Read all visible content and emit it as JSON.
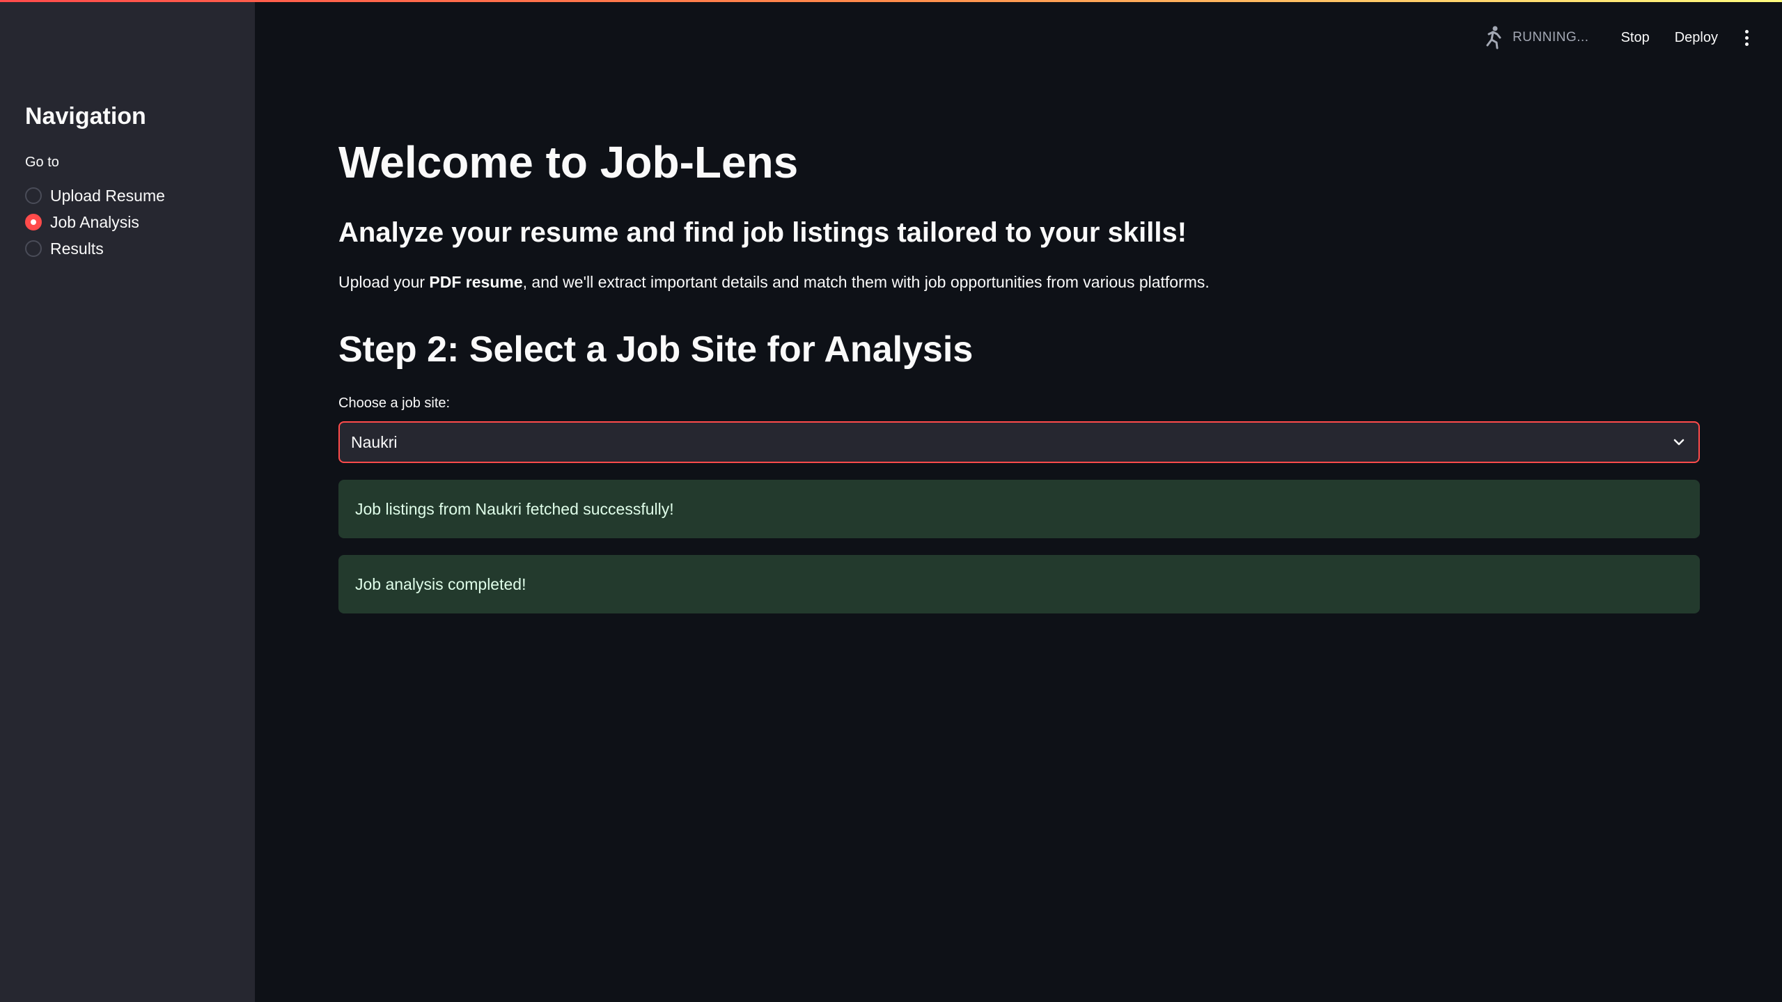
{
  "sidebar": {
    "title": "Navigation",
    "radio_label": "Go to",
    "items": [
      {
        "label": "Upload Resume",
        "selected": false
      },
      {
        "label": "Job Analysis",
        "selected": true
      },
      {
        "label": "Results",
        "selected": false
      }
    ]
  },
  "toolbar": {
    "status": "RUNNING...",
    "stop_label": "Stop",
    "deploy_label": "Deploy",
    "running_icon": "running-man-icon",
    "menu_icon": "kebab-menu-icon"
  },
  "main": {
    "title": "Welcome to Job-Lens",
    "subtitle": "Analyze your resume and find job listings tailored to your skills!",
    "intro_prefix": "Upload your ",
    "intro_bold": "PDF resume",
    "intro_suffix": ", and we'll extract important details and match them with job opportunities from various platforms.",
    "step_title": "Step 2: Select a Job Site for Analysis",
    "select_label": "Choose a job site:",
    "select_value": "Naukri",
    "alerts": [
      "Job listings from Naukri fetched successfully!",
      "Job analysis completed!"
    ]
  },
  "colors": {
    "background": "#0e1117",
    "sidebar": "#262730",
    "accent": "#ff4b4b",
    "success_bg": "#233a2d",
    "success_text": "#dffde9"
  }
}
